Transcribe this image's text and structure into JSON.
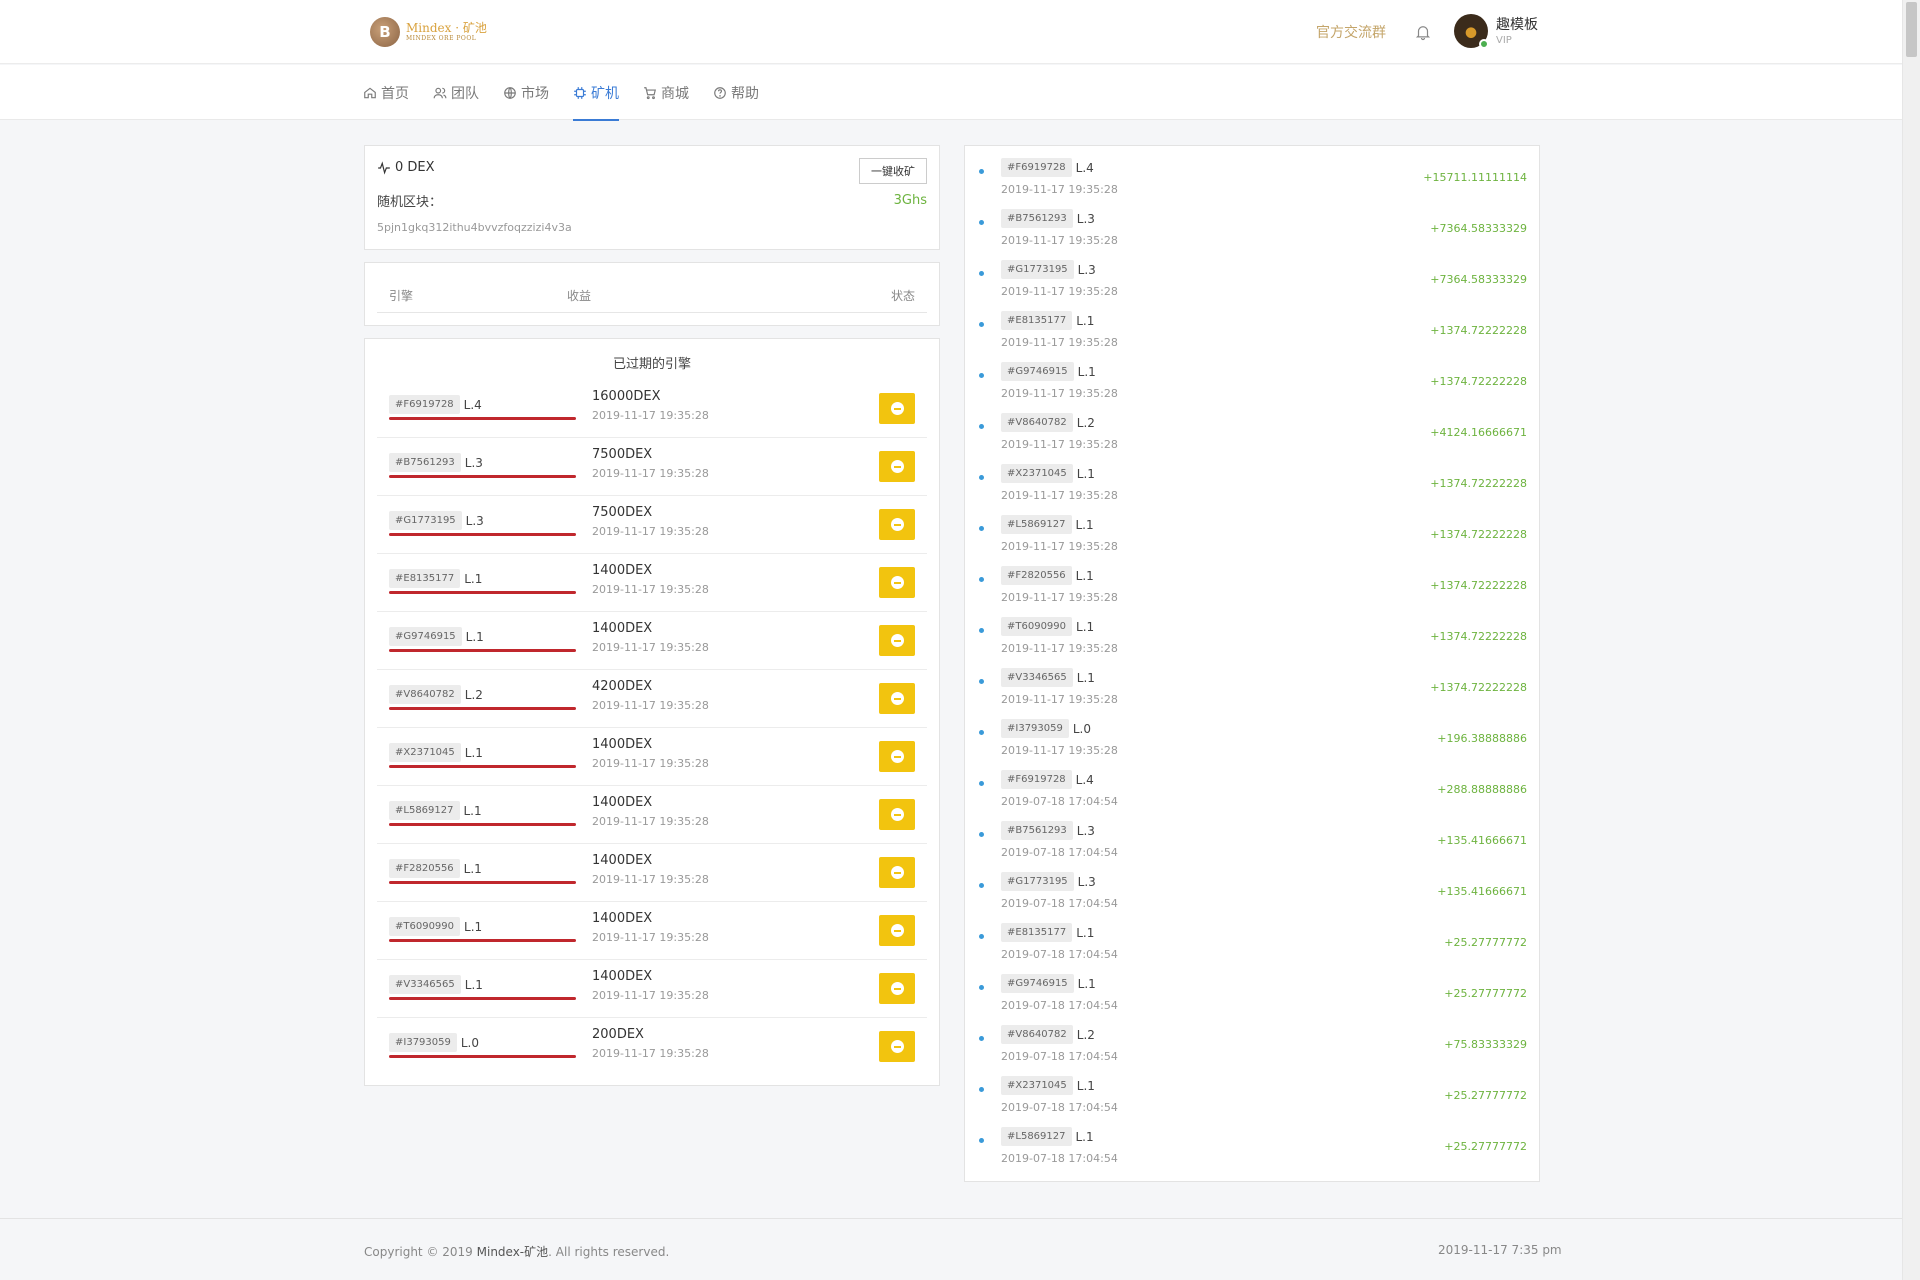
{
  "header": {
    "logo_text": "Mindex · 矿池",
    "logo_sub": "MINDEX ORE POOL",
    "logo_letter": "B",
    "community_link": "官方交流群",
    "user_name": "趣模板",
    "user_role": "VIP"
  },
  "nav": [
    {
      "label": "首页",
      "icon": "home-icon",
      "active": false
    },
    {
      "label": "团队",
      "icon": "team-icon",
      "active": false
    },
    {
      "label": "市场",
      "icon": "globe-icon",
      "active": false
    },
    {
      "label": "矿机",
      "icon": "chip-icon",
      "active": true
    },
    {
      "label": "商城",
      "icon": "cart-icon",
      "active": false
    },
    {
      "label": "帮助",
      "icon": "help-icon",
      "active": false
    }
  ],
  "wallet": {
    "balance": "0 DEX",
    "collect_button": "一键收矿",
    "block_label": "随机区块：",
    "hashrate": "3Ghs",
    "block_address": "5pjn1gkq312ithu4bvvzfoqzzizi4v3a"
  },
  "table_head": {
    "engine": "引擎",
    "income": "收益",
    "status": "状态"
  },
  "expired": {
    "title": "已过期的引擎",
    "rows": [
      {
        "id": "#F6919728",
        "level": "L.4",
        "amount": "16000DEX",
        "date": "2019-11-17 19:35:28"
      },
      {
        "id": "#B7561293",
        "level": "L.3",
        "amount": "7500DEX",
        "date": "2019-11-17 19:35:28"
      },
      {
        "id": "#G1773195",
        "level": "L.3",
        "amount": "7500DEX",
        "date": "2019-11-17 19:35:28"
      },
      {
        "id": "#E8135177",
        "level": "L.1",
        "amount": "1400DEX",
        "date": "2019-11-17 19:35:28"
      },
      {
        "id": "#G9746915",
        "level": "L.1",
        "amount": "1400DEX",
        "date": "2019-11-17 19:35:28"
      },
      {
        "id": "#V8640782",
        "level": "L.2",
        "amount": "4200DEX",
        "date": "2019-11-17 19:35:28"
      },
      {
        "id": "#X2371045",
        "level": "L.1",
        "amount": "1400DEX",
        "date": "2019-11-17 19:35:28"
      },
      {
        "id": "#L5869127",
        "level": "L.1",
        "amount": "1400DEX",
        "date": "2019-11-17 19:35:28"
      },
      {
        "id": "#F2820556",
        "level": "L.1",
        "amount": "1400DEX",
        "date": "2019-11-17 19:35:28"
      },
      {
        "id": "#T6090990",
        "level": "L.1",
        "amount": "1400DEX",
        "date": "2019-11-17 19:35:28"
      },
      {
        "id": "#V3346565",
        "level": "L.1",
        "amount": "1400DEX",
        "date": "2019-11-17 19:35:28"
      },
      {
        "id": "#I3793059",
        "level": "L.0",
        "amount": "200DEX",
        "date": "2019-11-17 19:35:28"
      }
    ]
  },
  "feed": [
    {
      "id": "#F6919728",
      "level": "L.4",
      "date": "2019-11-17 19:35:28",
      "gain": "+15711.11111114"
    },
    {
      "id": "#B7561293",
      "level": "L.3",
      "date": "2019-11-17 19:35:28",
      "gain": "+7364.58333329"
    },
    {
      "id": "#G1773195",
      "level": "L.3",
      "date": "2019-11-17 19:35:28",
      "gain": "+7364.58333329"
    },
    {
      "id": "#E8135177",
      "level": "L.1",
      "date": "2019-11-17 19:35:28",
      "gain": "+1374.72222228"
    },
    {
      "id": "#G9746915",
      "level": "L.1",
      "date": "2019-11-17 19:35:28",
      "gain": "+1374.72222228"
    },
    {
      "id": "#V8640782",
      "level": "L.2",
      "date": "2019-11-17 19:35:28",
      "gain": "+4124.16666671"
    },
    {
      "id": "#X2371045",
      "level": "L.1",
      "date": "2019-11-17 19:35:28",
      "gain": "+1374.72222228"
    },
    {
      "id": "#L5869127",
      "level": "L.1",
      "date": "2019-11-17 19:35:28",
      "gain": "+1374.72222228"
    },
    {
      "id": "#F2820556",
      "level": "L.1",
      "date": "2019-11-17 19:35:28",
      "gain": "+1374.72222228"
    },
    {
      "id": "#T6090990",
      "level": "L.1",
      "date": "2019-11-17 19:35:28",
      "gain": "+1374.72222228"
    },
    {
      "id": "#V3346565",
      "level": "L.1",
      "date": "2019-11-17 19:35:28",
      "gain": "+1374.72222228"
    },
    {
      "id": "#I3793059",
      "level": "L.0",
      "date": "2019-11-17 19:35:28",
      "gain": "+196.38888886"
    },
    {
      "id": "#F6919728",
      "level": "L.4",
      "date": "2019-07-18 17:04:54",
      "gain": "+288.88888886"
    },
    {
      "id": "#B7561293",
      "level": "L.3",
      "date": "2019-07-18 17:04:54",
      "gain": "+135.41666671"
    },
    {
      "id": "#G1773195",
      "level": "L.3",
      "date": "2019-07-18 17:04:54",
      "gain": "+135.41666671"
    },
    {
      "id": "#E8135177",
      "level": "L.1",
      "date": "2019-07-18 17:04:54",
      "gain": "+25.27777772"
    },
    {
      "id": "#G9746915",
      "level": "L.1",
      "date": "2019-07-18 17:04:54",
      "gain": "+25.27777772"
    },
    {
      "id": "#V8640782",
      "level": "L.2",
      "date": "2019-07-18 17:04:54",
      "gain": "+75.83333329"
    },
    {
      "id": "#X2371045",
      "level": "L.1",
      "date": "2019-07-18 17:04:54",
      "gain": "+25.27777772"
    },
    {
      "id": "#L5869127",
      "level": "L.1",
      "date": "2019-07-18 17:04:54",
      "gain": "+25.27777772"
    }
  ],
  "footer": {
    "copyright_prefix": "Copyright © 2019 ",
    "brand": "Mindex-矿池",
    "copyright_suffix": ". All rights reserved.",
    "datetime": "2019-11-17 7:35 pm"
  },
  "colors": {
    "accent": "#3a7bd5",
    "gain": "#6db33f",
    "stop_button": "#f2c40f",
    "bar": "#c0272d",
    "community": "#c4a56a"
  }
}
